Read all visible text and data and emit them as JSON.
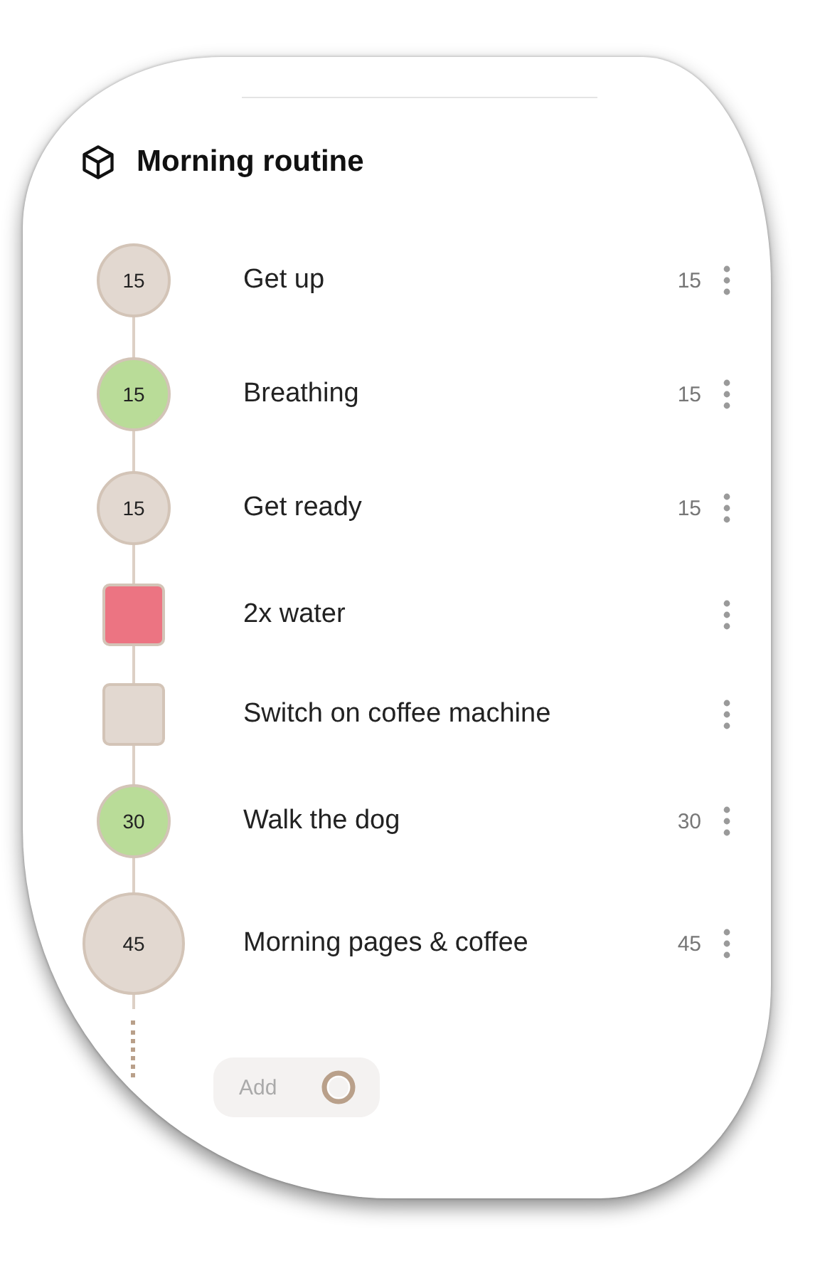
{
  "title": "Morning routine",
  "steps": [
    {
      "kind": "circle",
      "badge": "15",
      "color": "#e2d8d0",
      "label": "Get up",
      "duration": "15"
    },
    {
      "kind": "circle",
      "badge": "15",
      "color": "#b9dc98",
      "label": "Breathing",
      "duration": "15"
    },
    {
      "kind": "circle",
      "badge": "15",
      "color": "#e2d8d0",
      "label": "Get ready",
      "duration": "15"
    },
    {
      "kind": "square",
      "color": "#ec7482",
      "label": "2x water"
    },
    {
      "kind": "square",
      "color": "#e2d8d0",
      "label": "Switch on coffee machine"
    },
    {
      "kind": "circle",
      "badge": "30",
      "color": "#b9dc98",
      "label": "Walk the dog",
      "duration": "30"
    },
    {
      "kind": "bigcircle",
      "badge": "45",
      "color": "#e2d8d0",
      "label": "Morning pages & coffee",
      "duration": "45"
    }
  ],
  "add_button": {
    "label": "Add"
  }
}
